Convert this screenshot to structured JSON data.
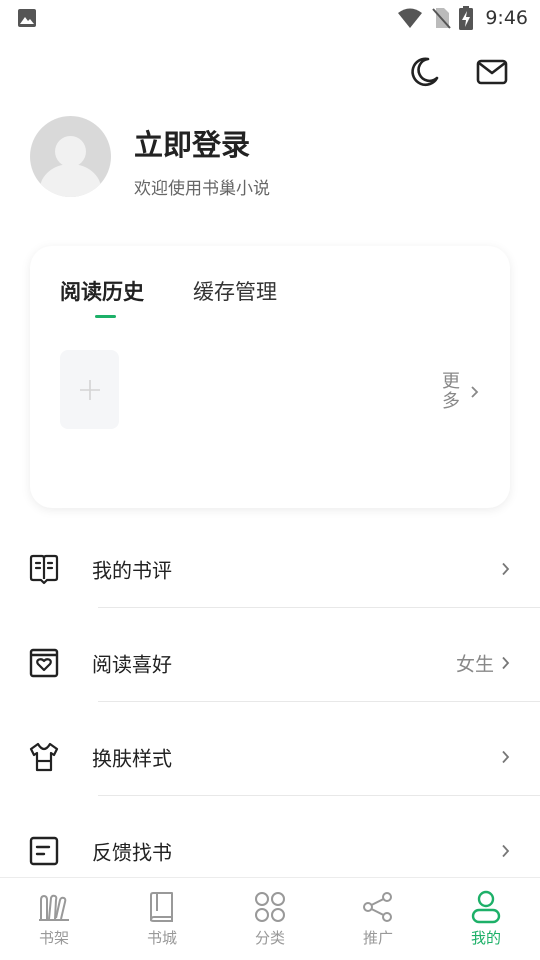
{
  "status_bar": {
    "time": "9:46"
  },
  "profile": {
    "title": "立即登录",
    "subtitle": "欢迎使用书巢小说"
  },
  "reading_card": {
    "tabs": [
      {
        "label": "阅读历史",
        "active": true
      },
      {
        "label": "缓存管理",
        "active": false
      }
    ],
    "more_label": "更多"
  },
  "menu": [
    {
      "label": "我的书评",
      "value": "",
      "icon": "book-review-icon"
    },
    {
      "label": "阅读喜好",
      "value": "女生",
      "icon": "heart-box-icon"
    },
    {
      "label": "换肤样式",
      "value": "",
      "icon": "shirt-icon"
    },
    {
      "label": "反馈找书",
      "value": "",
      "icon": "document-lines-icon"
    }
  ],
  "bottom_nav": [
    {
      "label": "书架",
      "icon": "bookshelf-icon",
      "active": false
    },
    {
      "label": "书城",
      "icon": "book-store-icon",
      "active": false
    },
    {
      "label": "分类",
      "icon": "category-icon",
      "active": false
    },
    {
      "label": "推广",
      "icon": "share-icon",
      "active": false
    },
    {
      "label": "我的",
      "icon": "profile-icon",
      "active": true
    }
  ],
  "colors": {
    "accent": "#1db068",
    "text": "#222222",
    "muted": "#888888",
    "divider": "#e8e8e8"
  }
}
